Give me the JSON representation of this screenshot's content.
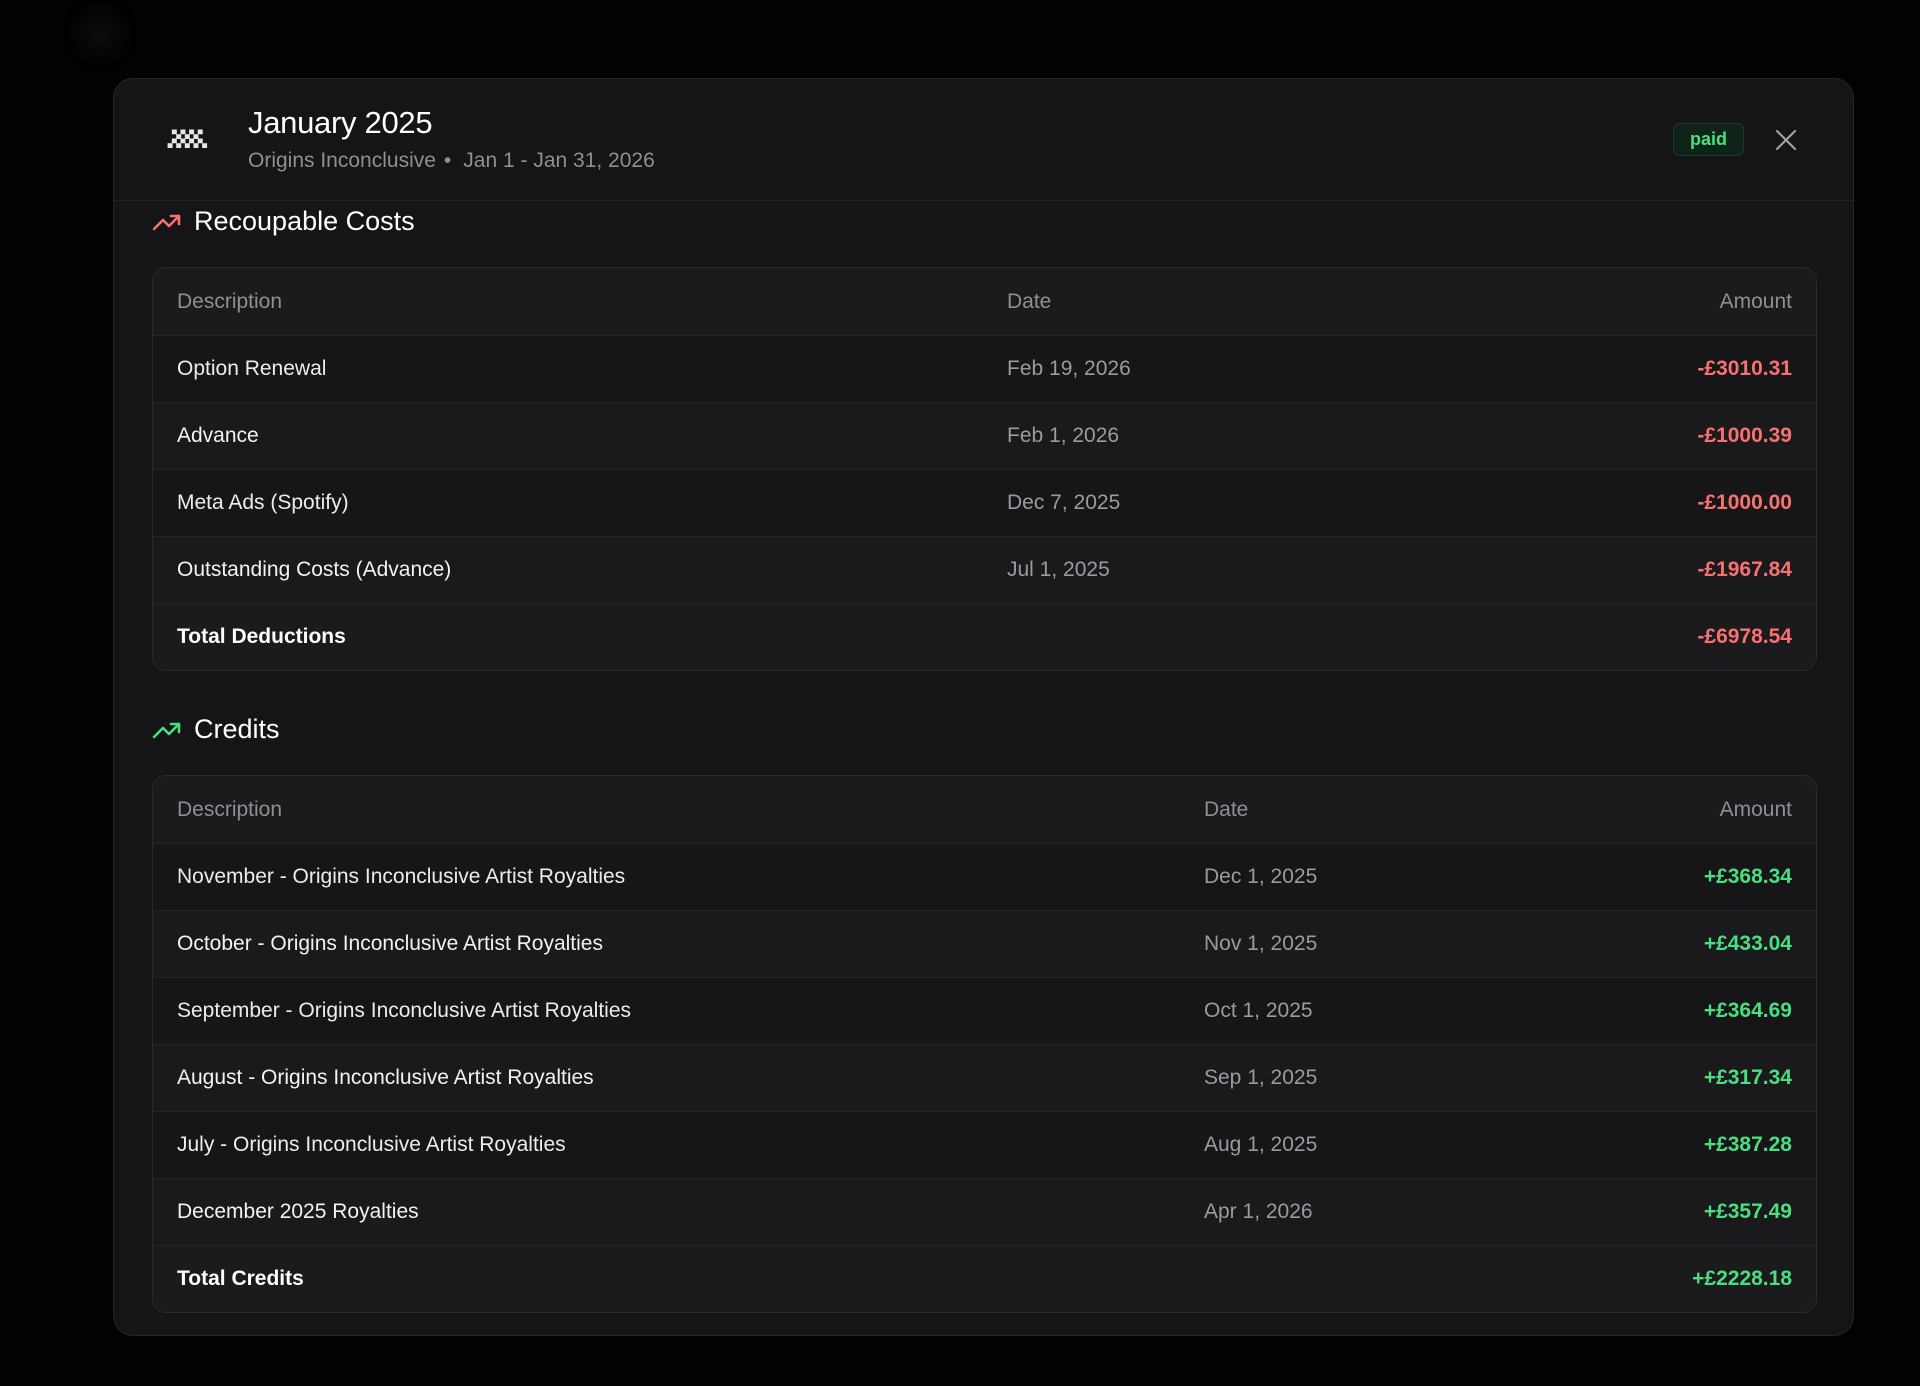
{
  "header": {
    "title": "January 2025",
    "artist": "Origins Inconclusive",
    "separator": "•",
    "period": "Jan 1 - Jan 31, 2026",
    "status": "paid",
    "logo_text": "Origins Inconclusive"
  },
  "recoupable": {
    "title": "Recoupable Costs",
    "columns": {
      "description": "Description",
      "date": "Date",
      "amount": "Amount"
    },
    "rows": [
      {
        "description": "Option Renewal",
        "date": "Feb 19, 2026",
        "amount": "-£3010.31"
      },
      {
        "description": "Advance",
        "date": "Feb 1, 2026",
        "amount": "-£1000.39"
      },
      {
        "description": "Meta Ads (Spotify)",
        "date": "Dec 7, 2025",
        "amount": "-£1000.00"
      },
      {
        "description": "Outstanding Costs (Advance)",
        "date": "Jul 1, 2025",
        "amount": "-£1967.84"
      }
    ],
    "total_label": "Total Deductions",
    "total_amount": "-£6978.54"
  },
  "credits": {
    "title": "Credits",
    "columns": {
      "description": "Description",
      "date": "Date",
      "amount": "Amount"
    },
    "rows": [
      {
        "description": "November - Origins Inconclusive Artist Royalties",
        "date": "Dec 1, 2025",
        "amount": "+£368.34"
      },
      {
        "description": "October - Origins Inconclusive Artist Royalties",
        "date": "Nov 1, 2025",
        "amount": "+£433.04"
      },
      {
        "description": "September - Origins Inconclusive Artist Royalties",
        "date": "Oct 1, 2025",
        "amount": "+£364.69"
      },
      {
        "description": "August - Origins Inconclusive Artist Royalties",
        "date": "Sep 1, 2025",
        "amount": "+£317.34"
      },
      {
        "description": "July - Origins Inconclusive Artist Royalties",
        "date": "Aug 1, 2025",
        "amount": "+£387.28"
      },
      {
        "description": "December 2025 Royalties",
        "date": "Apr 1, 2026",
        "amount": "+£357.49"
      }
    ],
    "total_label": "Total Credits",
    "total_amount": "+£2228.18"
  },
  "colors": {
    "negative": "#f87171",
    "positive": "#4ade80",
    "background": "#151517"
  },
  "icons": {
    "recoupable": "trending-up-icon",
    "credits": "trending-up-icon",
    "close": "close-icon"
  }
}
